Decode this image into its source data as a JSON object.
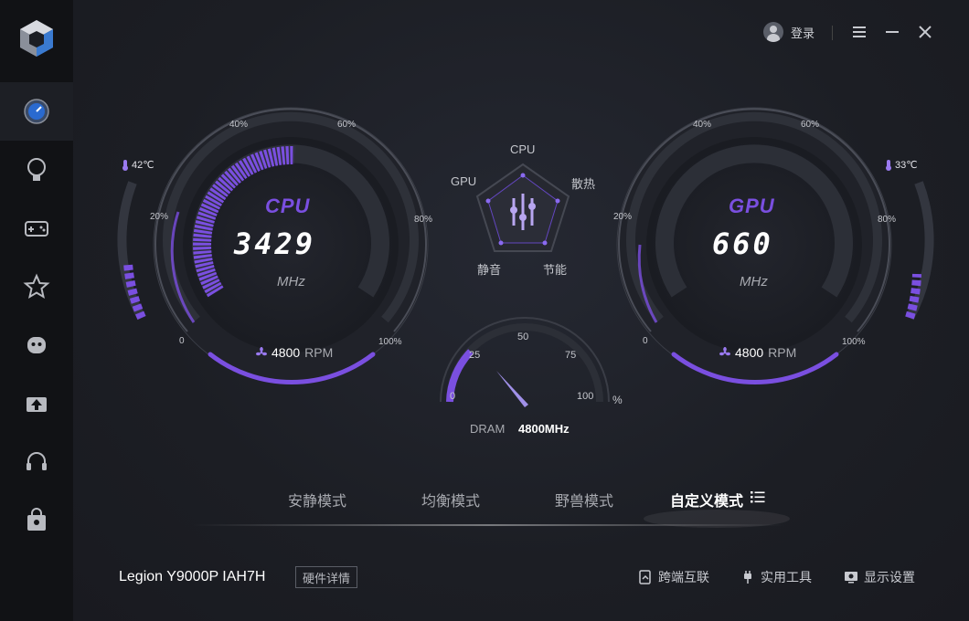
{
  "topbar": {
    "login_label": "登录"
  },
  "cpu": {
    "title": "CPU",
    "value": "3429",
    "unit": "MHz",
    "temp": "42℃",
    "fan_rpm": "4800",
    "fan_unit": "RPM",
    "ticks": [
      "0",
      "20%",
      "40%",
      "60%",
      "80%",
      "100%"
    ],
    "arc_level": 0.3
  },
  "gpu": {
    "title": "GPU",
    "value": "660",
    "unit": "MHz",
    "temp": "33℃",
    "fan_rpm": "4800",
    "fan_unit": "RPM",
    "ticks": [
      "0",
      "20%",
      "40%",
      "60%",
      "80%",
      "100%"
    ]
  },
  "radar": {
    "labels": {
      "top": "CPU",
      "left": "GPU",
      "right": "散热",
      "bottom_left": "静音",
      "bottom_right": "节能"
    }
  },
  "dram": {
    "label": "DRAM",
    "value": "4800MHz",
    "ticks": [
      "0",
      "25",
      "50",
      "75",
      "100"
    ],
    "unit": "%",
    "needle_percent": 35
  },
  "modes": {
    "items": [
      "安静模式",
      "均衡模式",
      "野兽模式",
      "自定义模式"
    ],
    "active": "自定义模式"
  },
  "footer": {
    "model": "Legion Y9000P IAH7H",
    "hardware_button": "硬件详情",
    "links": [
      "跨端互联",
      "实用工具",
      "显示设置"
    ]
  },
  "colors": {
    "accent": "#7a4fe0",
    "accent_light": "#9a7af0",
    "bg": "#1c1e24",
    "sidebar": "#111215"
  }
}
